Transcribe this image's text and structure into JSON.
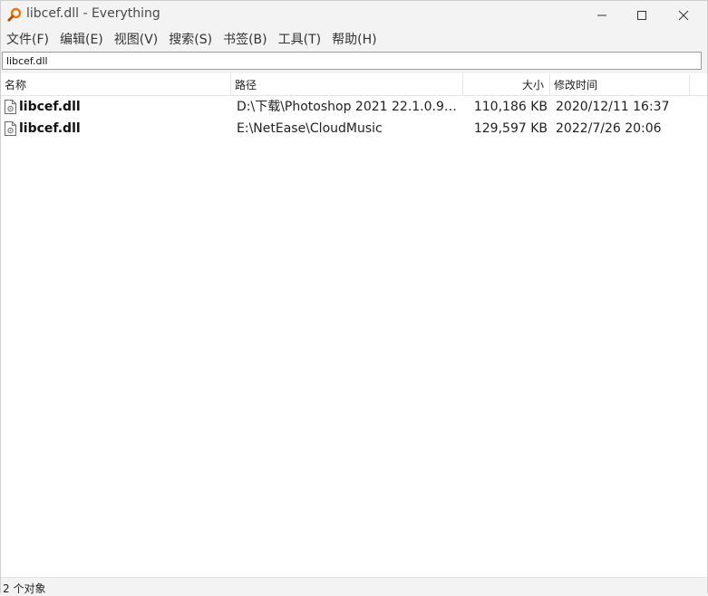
{
  "window": {
    "title": "libcef.dll - Everything"
  },
  "menu": [
    "文件(F)",
    "编辑(E)",
    "视图(V)",
    "搜索(S)",
    "书签(B)",
    "工具(T)",
    "帮助(H)"
  ],
  "search": {
    "value": "libcef.dll"
  },
  "columns": {
    "name": "名称",
    "path": "路径",
    "size": "大小",
    "modified": "修改时间"
  },
  "rows": [
    {
      "name": "libcef.dll",
      "path": "D:\\下载\\Photoshop 2021 22.1.0.94\\R...",
      "size": "110,186 KB",
      "modified": "2020/12/11 16:37"
    },
    {
      "name": "libcef.dll",
      "path": "E:\\NetEase\\CloudMusic",
      "size": "129,597 KB",
      "modified": "2022/7/26 20:06"
    }
  ],
  "status": {
    "text": "2 个对象"
  },
  "icons": {
    "app": "everything-magnifier-icon",
    "file": "dll-file-icon"
  },
  "colors": {
    "app_icon": "#e8770e"
  }
}
